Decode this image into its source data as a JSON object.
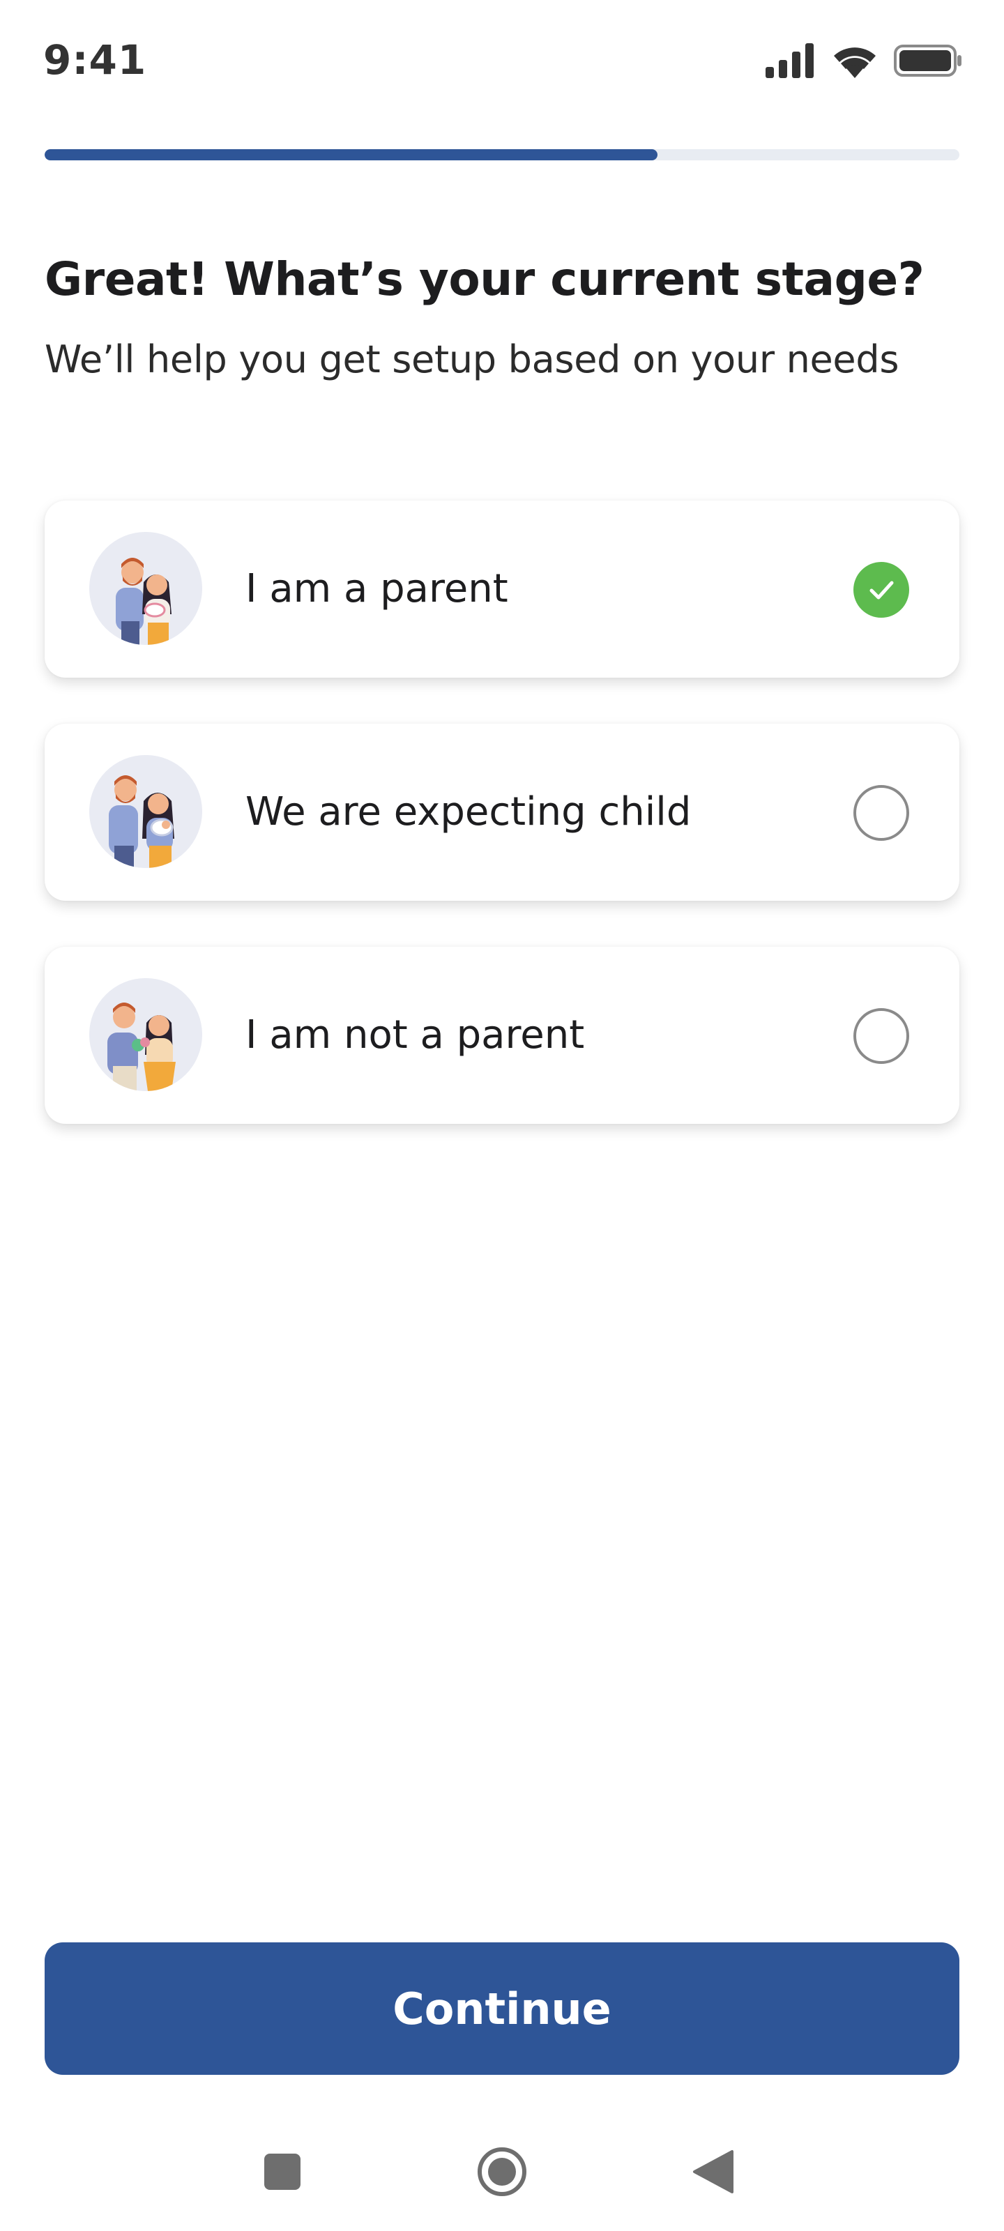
{
  "status_bar": {
    "time": "9:41",
    "icons": [
      "signal-icon",
      "wifi-icon",
      "battery-icon"
    ]
  },
  "progress": {
    "value": 0.67,
    "color": "#2e5597",
    "track_color": "#e8ecf2"
  },
  "title": "Great! What’s your current stage?",
  "subtitle": "We’ll help you get setup based on your needs",
  "options": [
    {
      "label": "I am a parent",
      "selected": true,
      "illustration": "family-with-baby-illustration"
    },
    {
      "label": "We are expecting child",
      "selected": false,
      "illustration": "couple-with-newborn-illustration"
    },
    {
      "label": "I am not a parent",
      "selected": false,
      "illustration": "couple-illustration"
    }
  ],
  "continue_label": "Continue",
  "colors": {
    "accent": "#2e5597",
    "selected": "#5dbb4e"
  },
  "nav_bar": {
    "icons": [
      "recent-apps-icon",
      "home-icon",
      "back-icon"
    ]
  }
}
